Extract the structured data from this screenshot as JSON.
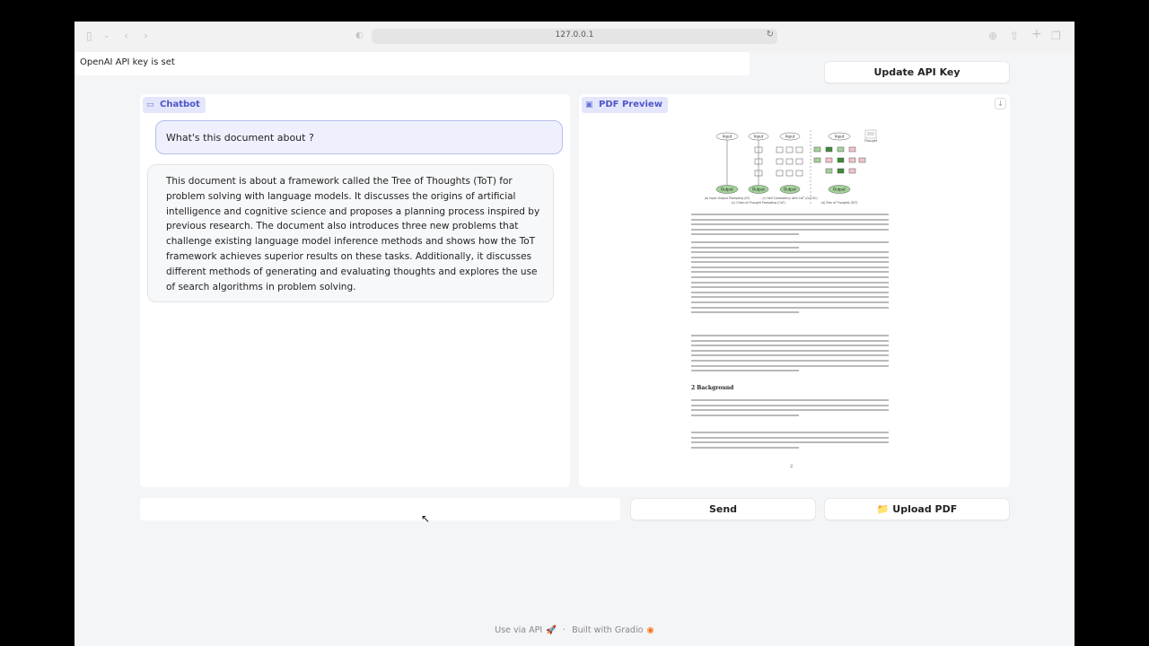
{
  "browser": {
    "url": "127.0.0.1",
    "icons": [
      "sidebar-icon",
      "chevron-down-icon",
      "back-icon",
      "forward-icon",
      "shield-icon",
      "reload-icon",
      "download-icon",
      "share-icon",
      "new-tab-icon",
      "tabs-overview-icon"
    ]
  },
  "status": {
    "text": "OpenAI API key is set"
  },
  "buttons": {
    "update_api_key": "Update API Key",
    "send": "Send",
    "upload_pdf": "📁 Upload PDF"
  },
  "chatbot": {
    "label": "Chatbot",
    "messages": [
      {
        "role": "user",
        "text": "What's this document about ?"
      },
      {
        "role": "bot",
        "text": "This document is about a framework called the Tree of Thoughts (ToT) for problem solving with language models. It discusses the origins of artificial intelligence and cognitive science and proposes a planning process inspired by previous research. The document also introduces three new problems that challenge existing language model inference methods and shows how the ToT framework achieves superior results on these tasks. Additionally, it discusses different methods of generating and evaluating thoughts and explores the use of search algorithms in problem solving."
      }
    ]
  },
  "pdf_preview": {
    "label": "PDF Preview",
    "page": {
      "section_heading": "2   Background",
      "page_number": "2",
      "figure_node_labels": [
        "Input",
        "Input",
        "Input",
        "Input",
        "Output",
        "Output",
        "Output",
        "Output"
      ],
      "figure_captions": [
        "(a) Input-Output Prompting (IO)",
        "(c) Chain of Thought Prompting (CoT)",
        "(c) Self Consistency with CoT (CoT-SC)",
        "(d) Tree of Thoughts (ToT)"
      ],
      "figure_legend": "Thought"
    }
  },
  "input": {
    "value": "",
    "placeholder": ""
  },
  "footer": {
    "use_api": "Use via API",
    "separator": "·",
    "built_with": "Built with Gradio"
  }
}
